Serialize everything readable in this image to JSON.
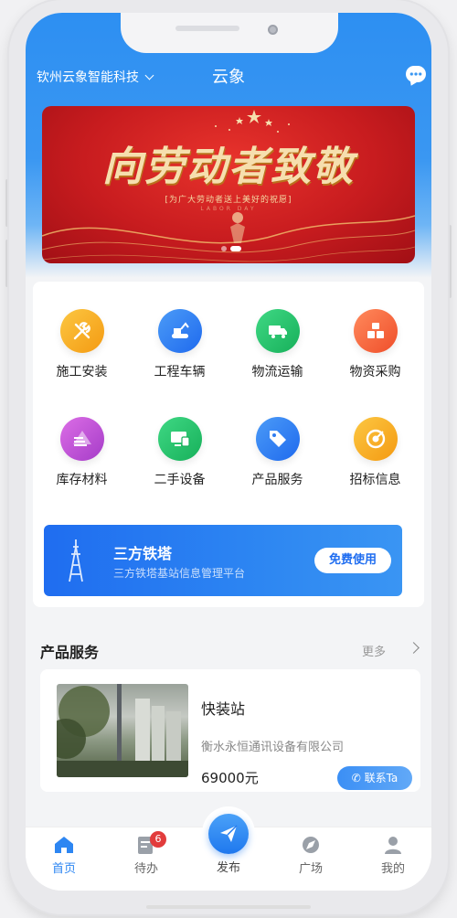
{
  "header": {
    "company": "钦州云象智能科技",
    "app_title": "云象"
  },
  "banner": {
    "headline": "向劳动者致敬",
    "subline": "[为广大劳动者送上美好的祝愿]",
    "subline_en": "LABOR DAY",
    "active_slide": 1,
    "slide_count": 2
  },
  "categories": [
    {
      "label": "施工安装",
      "icon": "wrench-screwdriver-icon",
      "color": "#f7b21d"
    },
    {
      "label": "工程车辆",
      "icon": "excavator-icon",
      "color": "#2f7cf0"
    },
    {
      "label": "物流运输",
      "icon": "truck-icon",
      "color": "#23c46b"
    },
    {
      "label": "物资采购",
      "icon": "boxes-icon",
      "color": "#f5663a"
    },
    {
      "label": "库存材料",
      "icon": "stack-icon",
      "color": "#c04fd6"
    },
    {
      "label": "二手设备",
      "icon": "devices-icon",
      "color": "#23c46b"
    },
    {
      "label": "产品服务",
      "icon": "tag-icon",
      "color": "#2f7cf0"
    },
    {
      "label": "招标信息",
      "icon": "target-icon",
      "color": "#f7a11d"
    }
  ],
  "promo": {
    "title": "三方铁塔",
    "description": "三方铁塔基站信息管理平台",
    "button": "免费使用"
  },
  "products_section": {
    "title": "产品服务",
    "more": "更多",
    "items": [
      {
        "name": "快装站",
        "company": "衡水永恒通讯设备有限公司",
        "price": "69000元",
        "contact_label": "联系Ta"
      }
    ]
  },
  "tabbar": {
    "tabs": [
      {
        "label": "首页",
        "icon": "home-icon",
        "active": true
      },
      {
        "label": "待办",
        "icon": "todo-icon",
        "badge": "6"
      },
      {
        "label": "发布",
        "icon": "paper-plane-icon"
      },
      {
        "label": "广场",
        "icon": "compass-icon"
      },
      {
        "label": "我的",
        "icon": "user-icon"
      }
    ]
  }
}
